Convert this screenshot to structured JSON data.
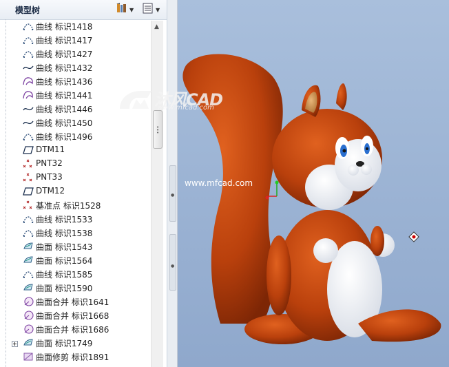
{
  "panel": {
    "title": "模型树",
    "buttons": [
      {
        "name": "settings-icon"
      },
      {
        "name": "tree-filter-icon"
      }
    ]
  },
  "tree": {
    "items": [
      {
        "label": "曲线 标识1418",
        "icon": "curve-dashed-icon"
      },
      {
        "label": "曲线 标识1417",
        "icon": "curve-dashed-icon"
      },
      {
        "label": "曲线 标识1427",
        "icon": "curve-dashed-icon"
      },
      {
        "label": "曲线 标识1432",
        "icon": "curve-icon"
      },
      {
        "label": "曲线 标识1436",
        "icon": "curve-sketch-icon"
      },
      {
        "label": "曲线 标识1441",
        "icon": "curve-sketch-icon"
      },
      {
        "label": "曲线 标识1446",
        "icon": "curve-icon"
      },
      {
        "label": "曲线 标识1450",
        "icon": "curve-icon"
      },
      {
        "label": "曲线 标识1496",
        "icon": "curve-dashed-icon"
      },
      {
        "label": "DTM11",
        "icon": "datum-plane-icon"
      },
      {
        "label": "PNT32",
        "icon": "datum-point-icon"
      },
      {
        "label": "PNT33",
        "icon": "datum-point-icon"
      },
      {
        "label": "DTM12",
        "icon": "datum-plane-icon"
      },
      {
        "label": "基准点 标识1528",
        "icon": "datum-point-icon"
      },
      {
        "label": "曲线 标识1533",
        "icon": "curve-dashed-icon"
      },
      {
        "label": "曲线 标识1538",
        "icon": "curve-dashed-icon"
      },
      {
        "label": "曲面 标识1543",
        "icon": "surface-icon"
      },
      {
        "label": "曲面 标识1564",
        "icon": "surface-icon"
      },
      {
        "label": "曲线 标识1585",
        "icon": "curve-dashed-icon"
      },
      {
        "label": "曲面 标识1590",
        "icon": "surface-icon"
      },
      {
        "label": "曲面合并 标识1641",
        "icon": "merge-icon"
      },
      {
        "label": "曲面合并 标识1668",
        "icon": "merge-icon"
      },
      {
        "label": "曲面合并 标识1686",
        "icon": "merge-icon"
      },
      {
        "label": "曲面 标识1749",
        "icon": "surface-icon",
        "expandable": true
      },
      {
        "label": "曲面修剪 标识1891",
        "icon": "trim-icon"
      }
    ]
  },
  "viewport": {
    "watermark_url": "www.mfcad.com",
    "logo_brand": "沐风CAD",
    "logo_url": "www.mfcad.com",
    "background": "#9db4d6"
  },
  "colors": {
    "accent": "#b8410c",
    "model_body": "#c0440f",
    "model_white": "#ffffff"
  }
}
